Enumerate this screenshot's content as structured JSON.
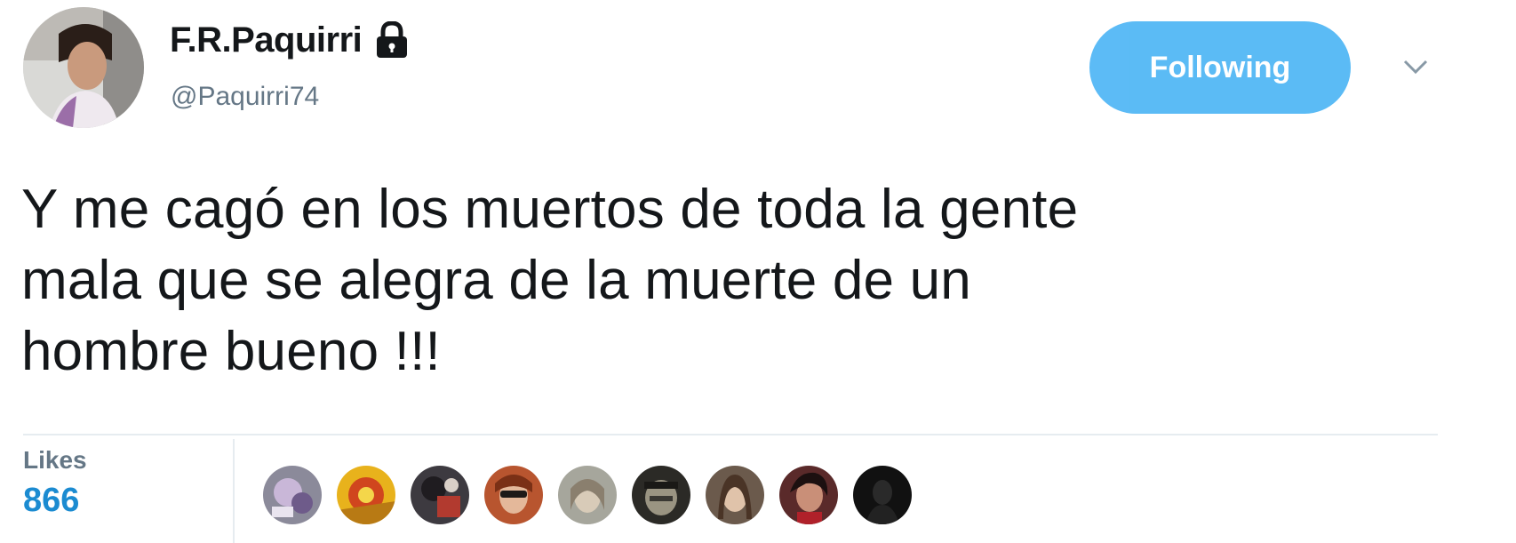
{
  "tweet": {
    "user": {
      "display_name": "F.R.Paquirri",
      "handle": "@Paquirri74",
      "protected_icon": "lock-icon"
    },
    "follow_button_label": "Following",
    "menu_icon": "chevron-down-icon",
    "text_lines": [
      "Y me cagó en los muertos de toda la gente",
      "mala que se alegra de la muerte de un",
      "hombre bueno !!!"
    ],
    "stats": {
      "likes_label": "Likes",
      "likes_count": "866"
    },
    "liker_avatar_count": 9
  },
  "colors": {
    "accent": "#1da1f2",
    "likes_count": "#1b8bd1",
    "muted_text": "#657786",
    "divider": "#e6ecf0",
    "text": "#14171a"
  }
}
